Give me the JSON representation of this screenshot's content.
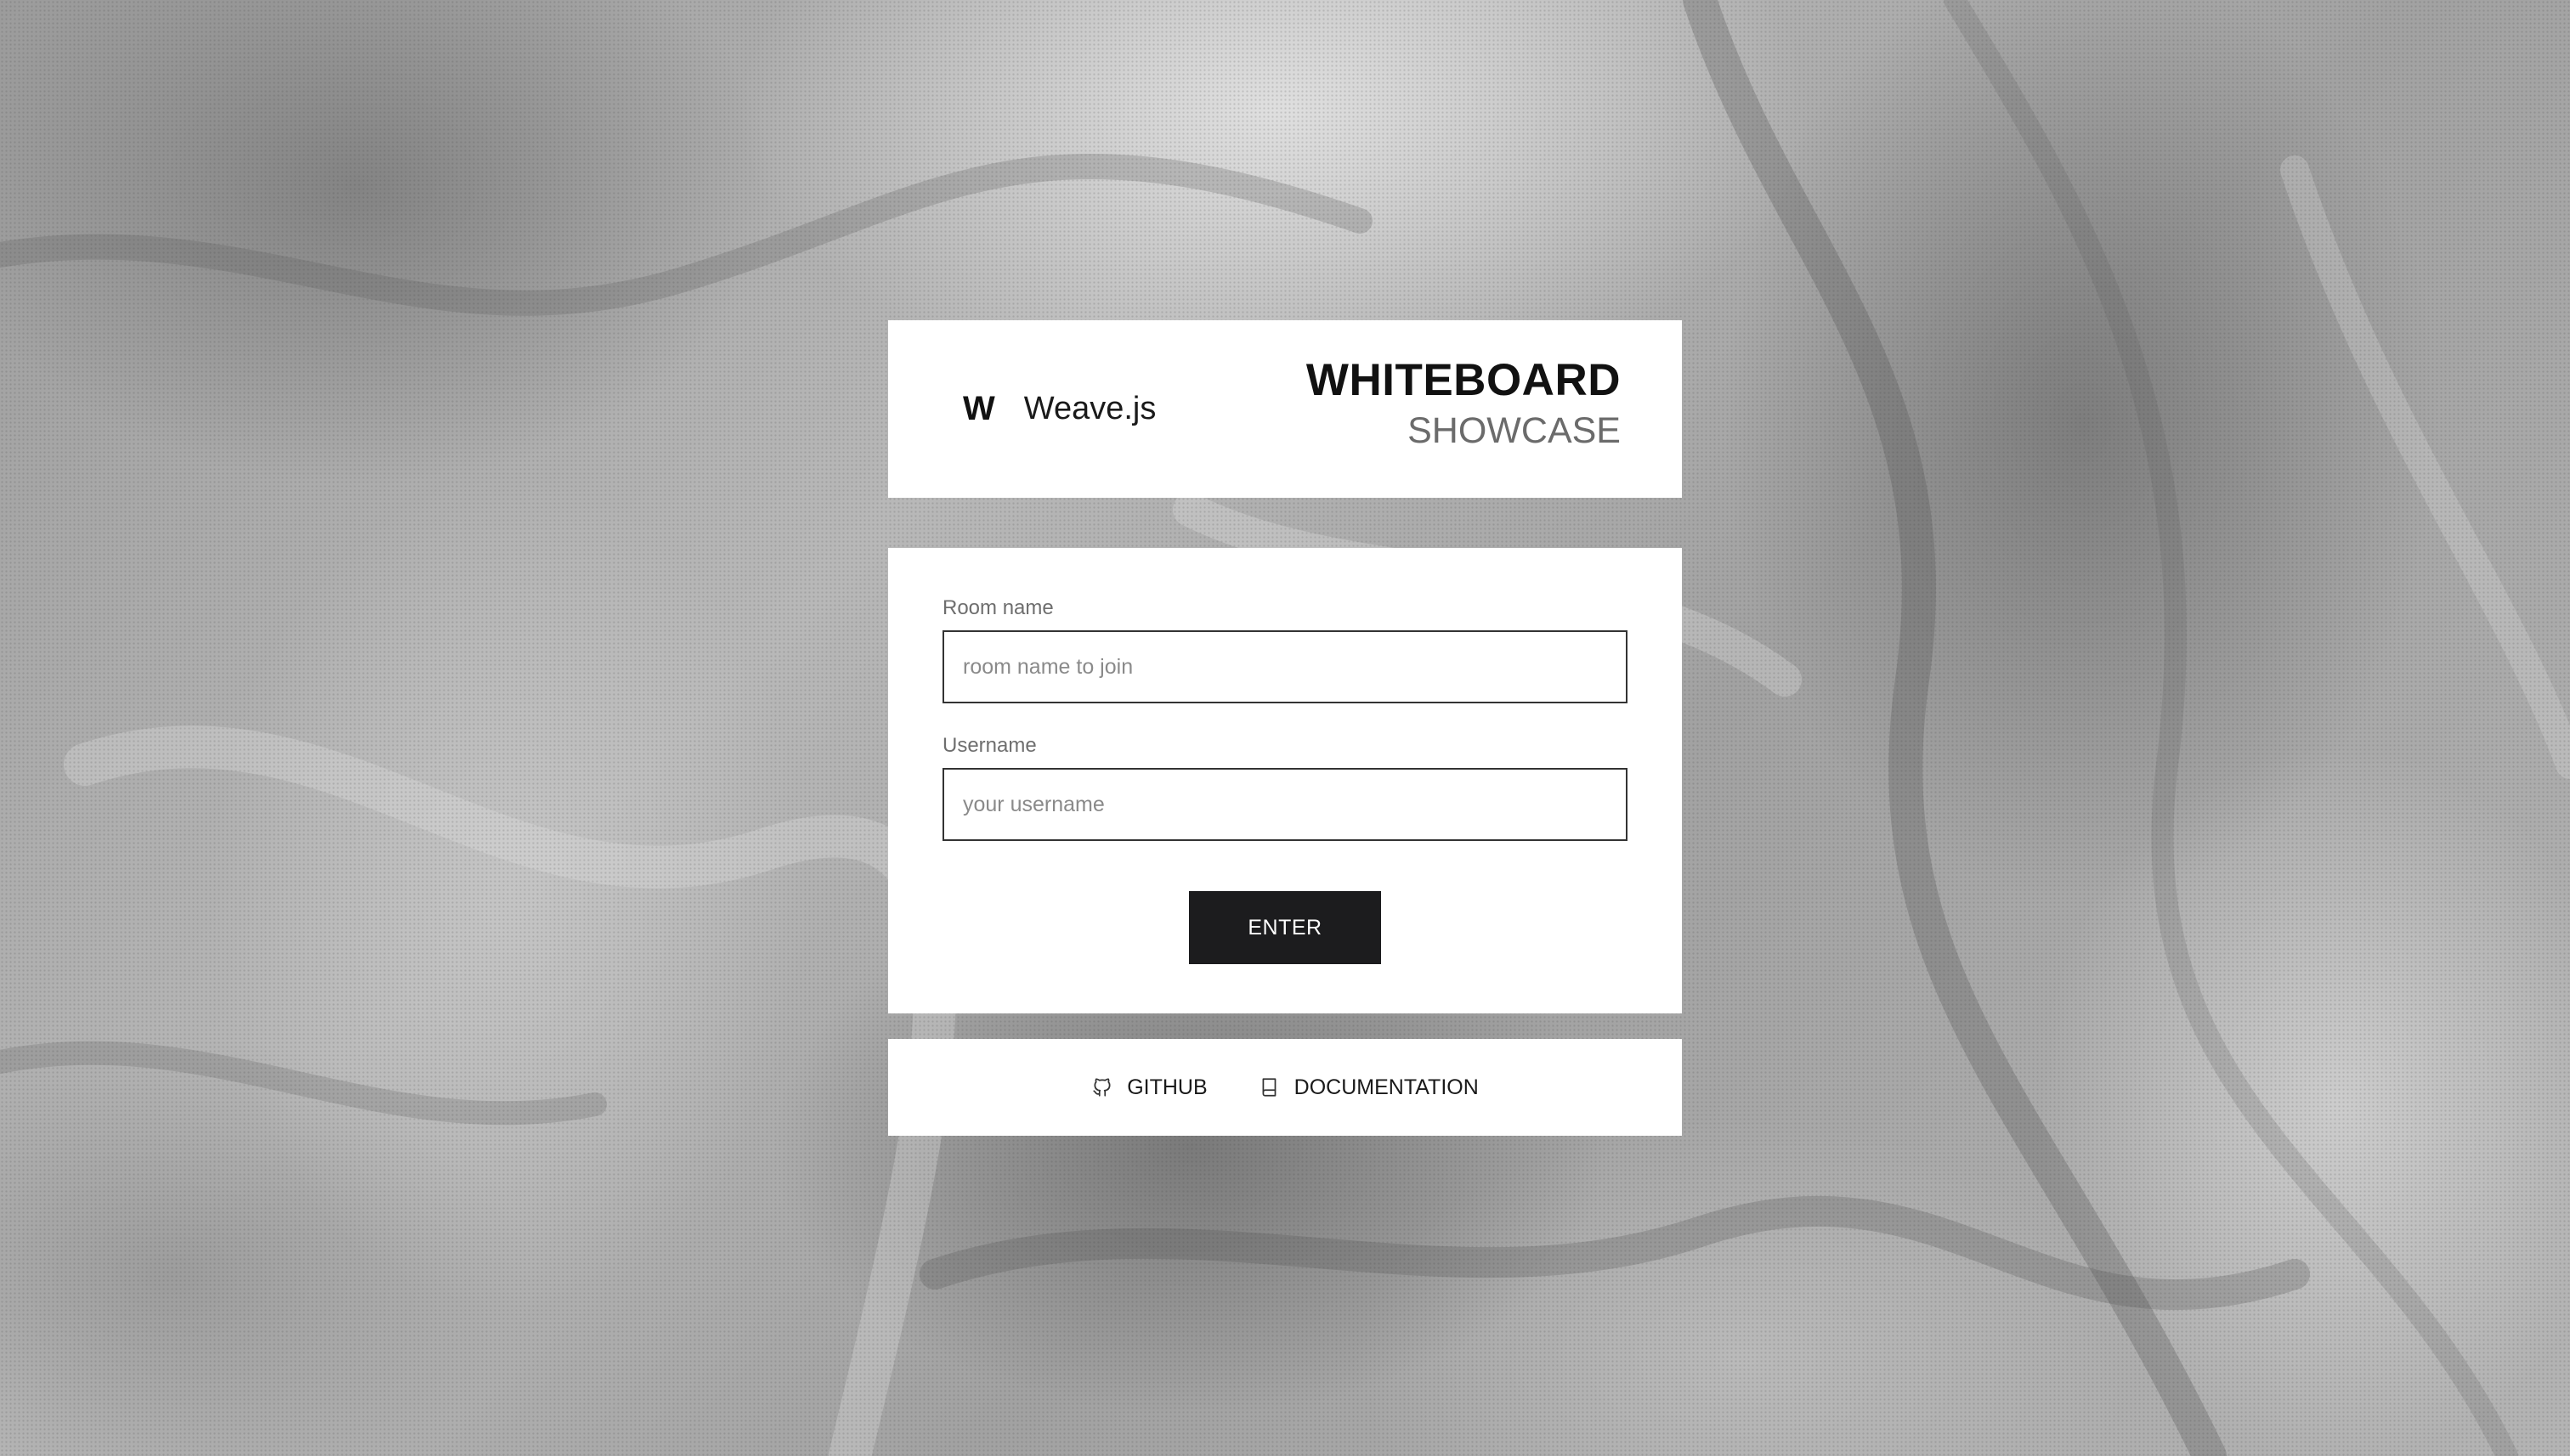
{
  "brand": {
    "logo_mark": "W",
    "name": "Weave.js"
  },
  "title": {
    "main": "WHITEBOARD",
    "sub": "SHOWCASE"
  },
  "form": {
    "room": {
      "label": "Room name",
      "placeholder": "room name to join",
      "value": ""
    },
    "username": {
      "label": "Username",
      "placeholder": "your username",
      "value": ""
    },
    "enter_label": "ENTER"
  },
  "footer": {
    "links": [
      {
        "label": "GITHUB",
        "icon": "github-icon"
      },
      {
        "label": "DOCUMENTATION",
        "icon": "book-icon"
      }
    ]
  },
  "colors": {
    "button_bg": "#1c1c1e",
    "panel_bg": "#ffffff",
    "subtitle": "#6b6b6b"
  }
}
